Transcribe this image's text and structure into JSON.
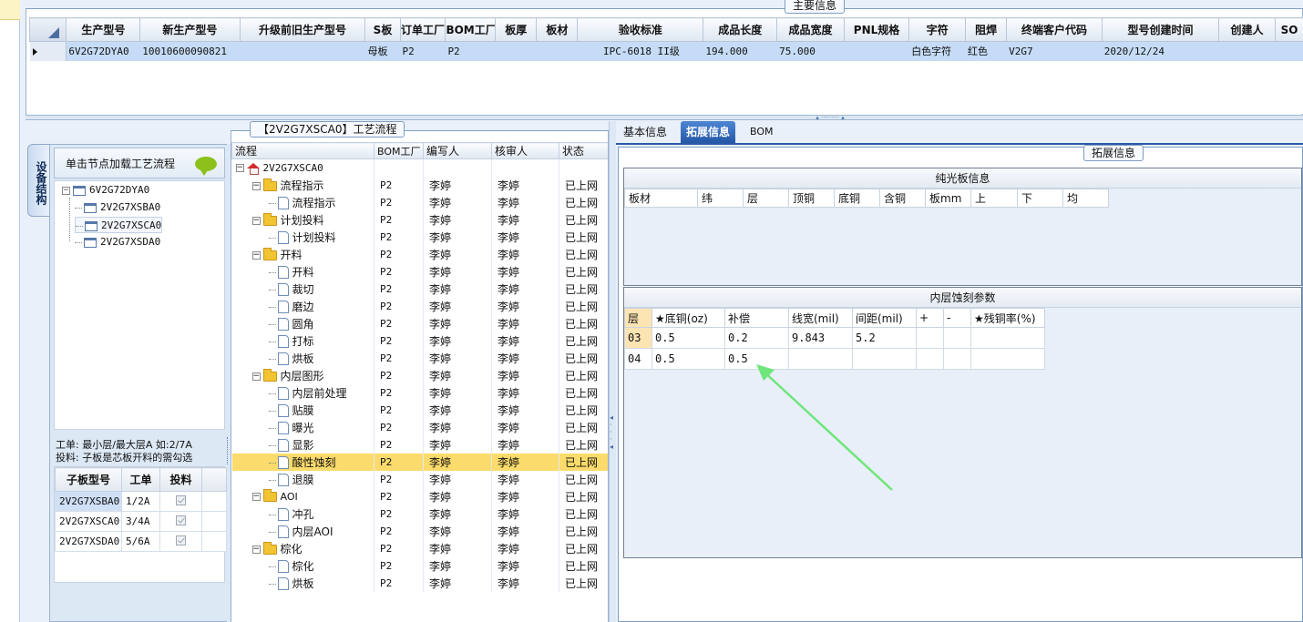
{
  "main_info": {
    "title": "主要信息",
    "columns": [
      "生产型号",
      "新生产型号",
      "升级前旧生产型号",
      "S板",
      "订单工厂",
      "BOM工厂",
      "板厚",
      "板材",
      "验收标准",
      "成品长度",
      "成品宽度",
      "PNL规格",
      "字符",
      "阻焊",
      "终端客户代码",
      "型号创建时间",
      "创建人",
      "SO"
    ],
    "rows": [
      [
        "6V2G72DYA0",
        "10010600090821",
        "",
        "母板",
        "P2",
        "P2",
        "",
        "",
        "IPC-6018 II级",
        "194.000",
        "75.000",
        "",
        "白色字符",
        "红色",
        "V2G7",
        "2020/12/24",
        "",
        ""
      ]
    ]
  },
  "left_panel": {
    "vertical_tab": "设备结构",
    "hint": "单击节点加载工艺流程",
    "tree": [
      "6V2G72DYA0",
      "2V2G7XSBA0",
      "2V2G7XSCA0",
      "2V2G7XSDA0"
    ],
    "note_line1": "工单: 最小层/最大层A 如:2/7A",
    "note_line2": "投料: 子板是芯板开料的需勾选",
    "sub_columns": [
      "子板型号",
      "工单",
      "投料"
    ],
    "sub_rows": [
      [
        "2V2G7XSBA0",
        "1/2A"
      ],
      [
        "2V2G7XSCA0",
        "3/4A"
      ],
      [
        "2V2G7XSDA0",
        "5/6A"
      ]
    ]
  },
  "flow": {
    "title": "【2V2G7XSCA0】工艺流程",
    "columns": [
      "流程",
      "BOM工厂",
      "编写人",
      "核审人",
      "状态"
    ],
    "root": "2V2G7XSCA0",
    "rows": [
      {
        "name": "流程指示",
        "folder": true,
        "bom": "P2",
        "writer": "李婷",
        "reviewer": "李婷",
        "status": "已上网"
      },
      {
        "name": "流程指示",
        "folder": false,
        "bom": "P2",
        "writer": "李婷",
        "reviewer": "李婷",
        "status": "已上网"
      },
      {
        "name": "计划投料",
        "folder": true,
        "bom": "P2",
        "writer": "李婷",
        "reviewer": "李婷",
        "status": "已上网"
      },
      {
        "name": "计划投料",
        "folder": false,
        "bom": "P2",
        "writer": "李婷",
        "reviewer": "李婷",
        "status": "已上网"
      },
      {
        "name": "开料",
        "folder": true,
        "bom": "P2",
        "writer": "李婷",
        "reviewer": "李婷",
        "status": "已上网"
      },
      {
        "name": "开料",
        "folder": false,
        "bom": "P2",
        "writer": "李婷",
        "reviewer": "李婷",
        "status": "已上网"
      },
      {
        "name": "裁切",
        "folder": false,
        "bom": "P2",
        "writer": "李婷",
        "reviewer": "李婷",
        "status": "已上网"
      },
      {
        "name": "磨边",
        "folder": false,
        "bom": "P2",
        "writer": "李婷",
        "reviewer": "李婷",
        "status": "已上网"
      },
      {
        "name": "圆角",
        "folder": false,
        "bom": "P2",
        "writer": "李婷",
        "reviewer": "李婷",
        "status": "已上网"
      },
      {
        "name": "打标",
        "folder": false,
        "bom": "P2",
        "writer": "李婷",
        "reviewer": "李婷",
        "status": "已上网"
      },
      {
        "name": "烘板",
        "folder": false,
        "bom": "P2",
        "writer": "李婷",
        "reviewer": "李婷",
        "status": "已上网"
      },
      {
        "name": "内层图形",
        "folder": true,
        "bom": "P2",
        "writer": "李婷",
        "reviewer": "李婷",
        "status": "已上网"
      },
      {
        "name": "内层前处理",
        "folder": false,
        "bom": "P2",
        "writer": "李婷",
        "reviewer": "李婷",
        "status": "已上网"
      },
      {
        "name": "贴膜",
        "folder": false,
        "bom": "P2",
        "writer": "李婷",
        "reviewer": "李婷",
        "status": "已上网"
      },
      {
        "name": "曝光",
        "folder": false,
        "bom": "P2",
        "writer": "李婷",
        "reviewer": "李婷",
        "status": "已上网"
      },
      {
        "name": "显影",
        "folder": false,
        "bom": "P2",
        "writer": "李婷",
        "reviewer": "李婷",
        "status": "已上网"
      },
      {
        "name": "酸性蚀刻",
        "folder": false,
        "bom": "P2",
        "writer": "李婷",
        "reviewer": "李婷",
        "status": "已上网",
        "selected": true
      },
      {
        "name": "退膜",
        "folder": false,
        "bom": "P2",
        "writer": "李婷",
        "reviewer": "李婷",
        "status": "已上网"
      },
      {
        "name": "AOI",
        "folder": true,
        "bom": "P2",
        "writer": "李婷",
        "reviewer": "李婷",
        "status": "已上网"
      },
      {
        "name": "冲孔",
        "folder": false,
        "bom": "P2",
        "writer": "李婷",
        "reviewer": "李婷",
        "status": "已上网"
      },
      {
        "name": "内层AOI",
        "folder": false,
        "bom": "P2",
        "writer": "李婷",
        "reviewer": "李婷",
        "status": "已上网"
      },
      {
        "name": "棕化",
        "folder": true,
        "bom": "P2",
        "writer": "李婷",
        "reviewer": "李婷",
        "status": "已上网"
      },
      {
        "name": "棕化",
        "folder": false,
        "bom": "P2",
        "writer": "李婷",
        "reviewer": "李婷",
        "status": "已上网"
      },
      {
        "name": "烘板",
        "folder": false,
        "bom": "P2",
        "writer": "李婷",
        "reviewer": "李婷",
        "status": "已上网"
      }
    ]
  },
  "right_panel": {
    "tabs": [
      "基本信息",
      "拓展信息",
      "BOM"
    ],
    "active_tab": 1,
    "group_title": "拓展信息",
    "plain_board": {
      "title": "纯光板信息",
      "columns": [
        "板材",
        "纬",
        "层",
        "顶铜",
        "底铜",
        "含铜",
        "板mm",
        "上",
        "下",
        "均"
      ]
    },
    "etch": {
      "title": "内层蚀刻参数",
      "columns": [
        "层",
        "★底铜(oz)",
        "补偿",
        "线宽(mil)",
        "间距(mil)",
        "+",
        "-",
        "★残铜率(%)"
      ],
      "rows": [
        [
          "03",
          "0.5",
          "0.2",
          "9.843",
          "5.2",
          "",
          "",
          ""
        ],
        [
          "04",
          "0.5",
          "0.5",
          "",
          "",
          "",
          "",
          ""
        ]
      ]
    }
  },
  "colors": {
    "accent": "#2f66b8",
    "selection": "#fbdb6b",
    "arrow": "#6ee67b"
  }
}
